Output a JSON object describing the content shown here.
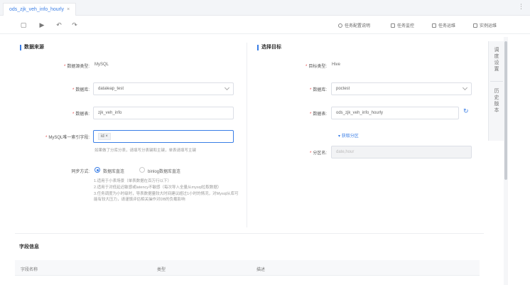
{
  "tab": {
    "title": "ods_zjk_veh_info_hourly",
    "close": "×"
  },
  "toolbar": {
    "actions": [
      {
        "label": "任务配置说明",
        "icon": "info-icon"
      },
      {
        "label": "任务监控",
        "icon": "monitor-icon"
      },
      {
        "label": "任务运维",
        "icon": "ops-icon"
      },
      {
        "label": "实例运维",
        "icon": "instance-icon"
      }
    ]
  },
  "source": {
    "title": "数据来源",
    "type_label": "数据源类型:",
    "type_value": "MySQL",
    "db_label": "数据库:",
    "db_value": "dataleap_test",
    "table_label": "数据表:",
    "table_value": "zjk_veh_info",
    "key_label": "MySQL唯一索引字段:",
    "key_tag": "id ×",
    "key_hint": "如果做了分库分表，请填写分表键和主键，单表请填写主键",
    "sync_label": "同步方式:",
    "sync_opt1": "数据库直连",
    "sync_opt2": "binlog数据库直连",
    "notes": "1.适用于小表场景（单表数据在百万行以下）\n2.适用于对低延迟敏感或latency不敏感（每次导入全量从mysql拉取数据）\n3.任务调度为小时级时，导表数据量较大时间建议超过1小时的情况，对Mysql从库可能有较大压力，请谨慎评估相关操作对DB的负载影响"
  },
  "target": {
    "title": "选择目标",
    "type_label": "目标类型:",
    "type_value": "Hive",
    "db_label": "数据库:",
    "db_value": "poctest",
    "table_label": "数据表:",
    "table_value": "ods_zjk_veh_info_hourly",
    "partition_link": "获取分区",
    "partition_label": "分区名:",
    "partition_value": "date,hour"
  },
  "fields": {
    "title": "字段信息",
    "columns": [
      "字段名称",
      "类型",
      "描述"
    ]
  },
  "side": {
    "tab1": [
      "调",
      "度",
      "设",
      "置"
    ],
    "tab2": [
      "历",
      "史",
      "版",
      "本"
    ]
  },
  "colors": {
    "accent": "#3a7ee6",
    "required": "#e54545"
  }
}
